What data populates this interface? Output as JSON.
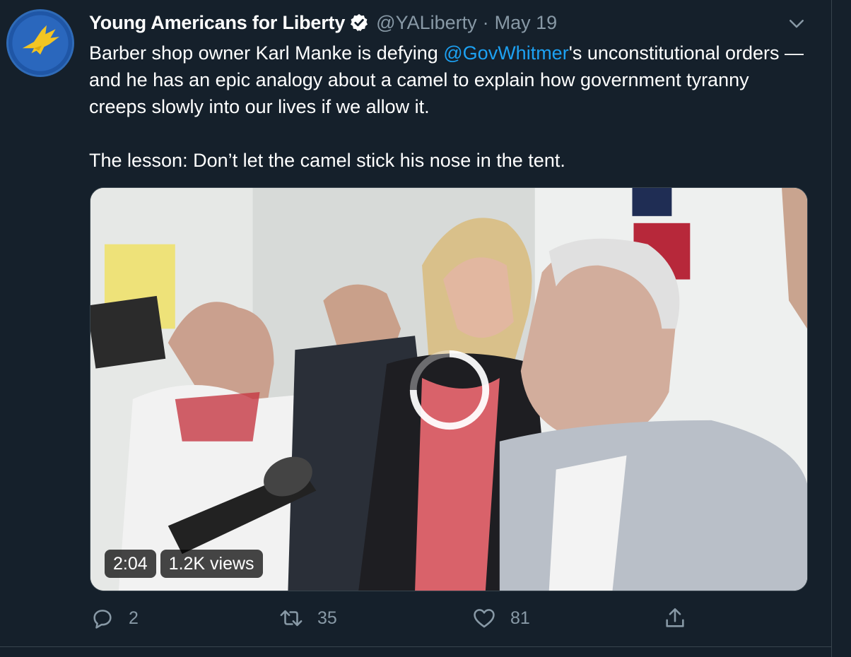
{
  "tweet": {
    "display_name": "Young Americans for Liberty",
    "handle": "@YALiberty",
    "separator": "·",
    "date": "May 19",
    "text": {
      "line1_before": "Barber shop owner Karl Manke is defying ",
      "mention": "@GovWhitmer",
      "line1_after": "'s unconstitutional orders — and he has an epic analogy about a camel to explain how government tyranny creeps slowly into our lives if we allow it.",
      "paragraph2": "The lesson: Don’t let the camel stick his nose in the tent."
    },
    "video": {
      "duration": "2:04",
      "views": "1.2K views",
      "loading": true
    },
    "actions": {
      "reply_count": "2",
      "retweet_count": "35",
      "like_count": "81"
    }
  },
  "icons": {
    "avatar": "yal-eagle-logo",
    "verified": "verified-badge-icon",
    "menu": "chevron-down-icon",
    "reply": "reply-icon",
    "retweet": "retweet-icon",
    "like": "heart-icon",
    "share": "share-icon"
  },
  "colors": {
    "background": "#15202b",
    "text": "#ffffff",
    "secondary": "#8899a6",
    "link": "#1da1f2",
    "border": "#38444d"
  }
}
